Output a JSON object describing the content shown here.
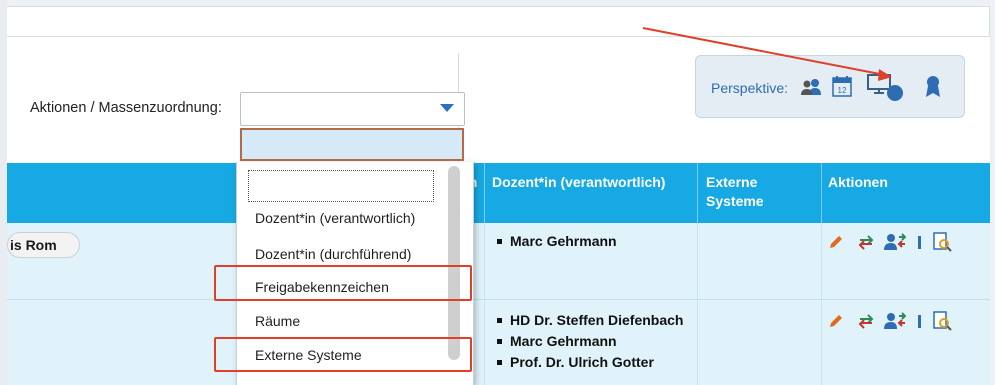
{
  "actions": {
    "label": "Aktionen / Massenzuordnung:",
    "select_value": ""
  },
  "perspective": {
    "label": "Perspektive:",
    "icons": [
      "users-icon",
      "calendar-icon",
      "monitor-icon",
      "award-icon"
    ],
    "calendar_day": "12"
  },
  "table": {
    "headers": {
      "cut_left": "en",
      "dozent": "Dozent*in (verantwortlich)",
      "externe": "Externe Systeme",
      "aktionen": "Aktionen"
    },
    "rows": [
      {
        "room": "is Rom",
        "dozenten": [
          "Marc Gehrmann"
        ]
      },
      {
        "room": "",
        "dozenten": [
          "HD Dr. Steffen Diefenbach",
          "Marc Gehrmann",
          "Prof. Dr. Ulrich Gotter"
        ]
      }
    ]
  },
  "dropdown": {
    "options": [
      "",
      "Dozent*in (verantwortlich)",
      "Dozent*in (durchführend)",
      "Freigabekennzeichen",
      "Räume",
      "Externe Systeme"
    ]
  },
  "colors": {
    "header_blue": "#17a9e3",
    "row_bg": "#e0f3fb",
    "annotation_red": "#e0402a",
    "perspective_blue": "#2e6db4"
  }
}
